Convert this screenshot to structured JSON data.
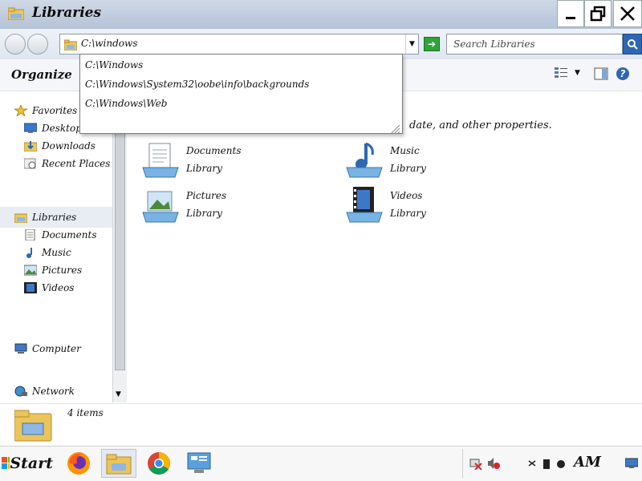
{
  "window": {
    "title": "Libraries",
    "controls": {
      "minimize": "_",
      "maximize": "❐",
      "close": "✕"
    }
  },
  "address": {
    "value": "C:\\windows",
    "suggestions": [
      "C:\\Windows",
      "C:\\Windows\\System32\\oobe\\info\\backgrounds",
      "C:\\Windows\\Web"
    ]
  },
  "search": {
    "placeholder": "Search Libraries"
  },
  "toolbar": {
    "organize": "Organize"
  },
  "nav": {
    "favorites_label": "Favorites",
    "favorites": [
      "Desktop",
      "Downloads",
      "Recent Places"
    ],
    "libraries_label": "Libraries",
    "libraries": [
      "Documents",
      "Music",
      "Pictures",
      "Videos"
    ],
    "computer": "Computer",
    "network": "Network"
  },
  "main": {
    "hint_text": "date, and other properties.",
    "libraries": [
      {
        "name": "Documents",
        "type": "Library",
        "icon": "documents-library-icon"
      },
      {
        "name": "Music",
        "type": "Library",
        "icon": "music-library-icon"
      },
      {
        "name": "Pictures",
        "type": "Library",
        "icon": "pictures-library-icon"
      },
      {
        "name": "Videos",
        "type": "Library",
        "icon": "videos-library-icon"
      }
    ]
  },
  "details": {
    "count": "4 items"
  },
  "taskbar": {
    "start_label": "Start",
    "clock_text": "AM",
    "apps": [
      "firefox-icon",
      "file-explorer-icon",
      "chrome-icon",
      "control-panel-icon"
    ]
  },
  "colors": {
    "accent": "#2d67b3",
    "titlebar": "#b5c3d7",
    "go": "#2fa33a"
  }
}
